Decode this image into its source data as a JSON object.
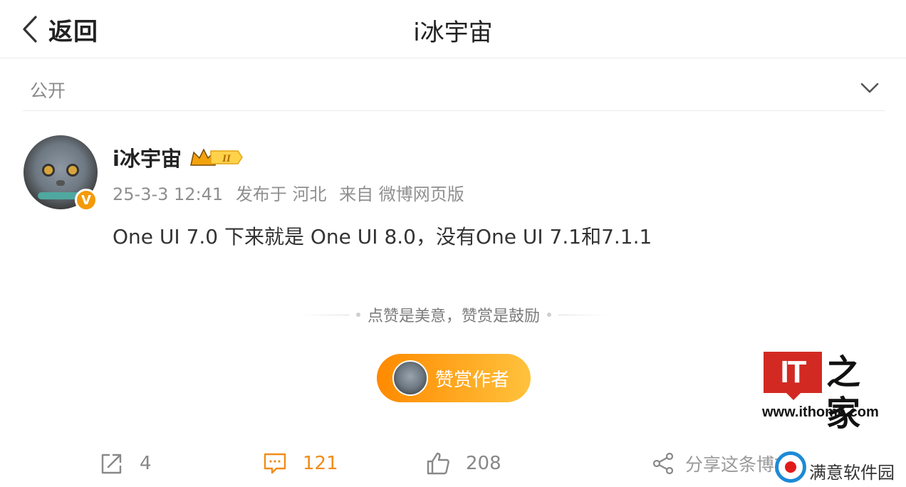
{
  "nav": {
    "back_label": "返回",
    "title": "i冰宇宙"
  },
  "visibility": {
    "label": "公开"
  },
  "post": {
    "author": "i冰宇宙",
    "level_badge": "II",
    "verified_badge": "V",
    "date": "25-3-3 12:41",
    "published_from": "发布于 河北",
    "source": "来自 微博网页版",
    "text": "One UI 7.0 下来就是 One UI 8.0，没有One UI 7.1和7.1.1"
  },
  "reward": {
    "tagline": "点赞是美意，赞赏是鼓励",
    "button_label": "赞赏作者"
  },
  "actions": {
    "repost_count": "4",
    "comment_count": "121",
    "like_count": "208",
    "share_label": "分享这条博文"
  },
  "watermarks": {
    "it_logo_text": "IT",
    "it_logo_home": "之家",
    "it_url": "www.ithome.com",
    "myk_text": "满意软件园"
  },
  "colors": {
    "accent_orange": "#f08c1a",
    "verified_orange": "#f49a0a",
    "ithome_red": "#d22a23"
  },
  "icons": [
    "back-chevron-icon",
    "dropdown-chevron-icon",
    "crown-icon",
    "repost-icon",
    "comment-icon",
    "like-icon",
    "share-icon"
  ]
}
